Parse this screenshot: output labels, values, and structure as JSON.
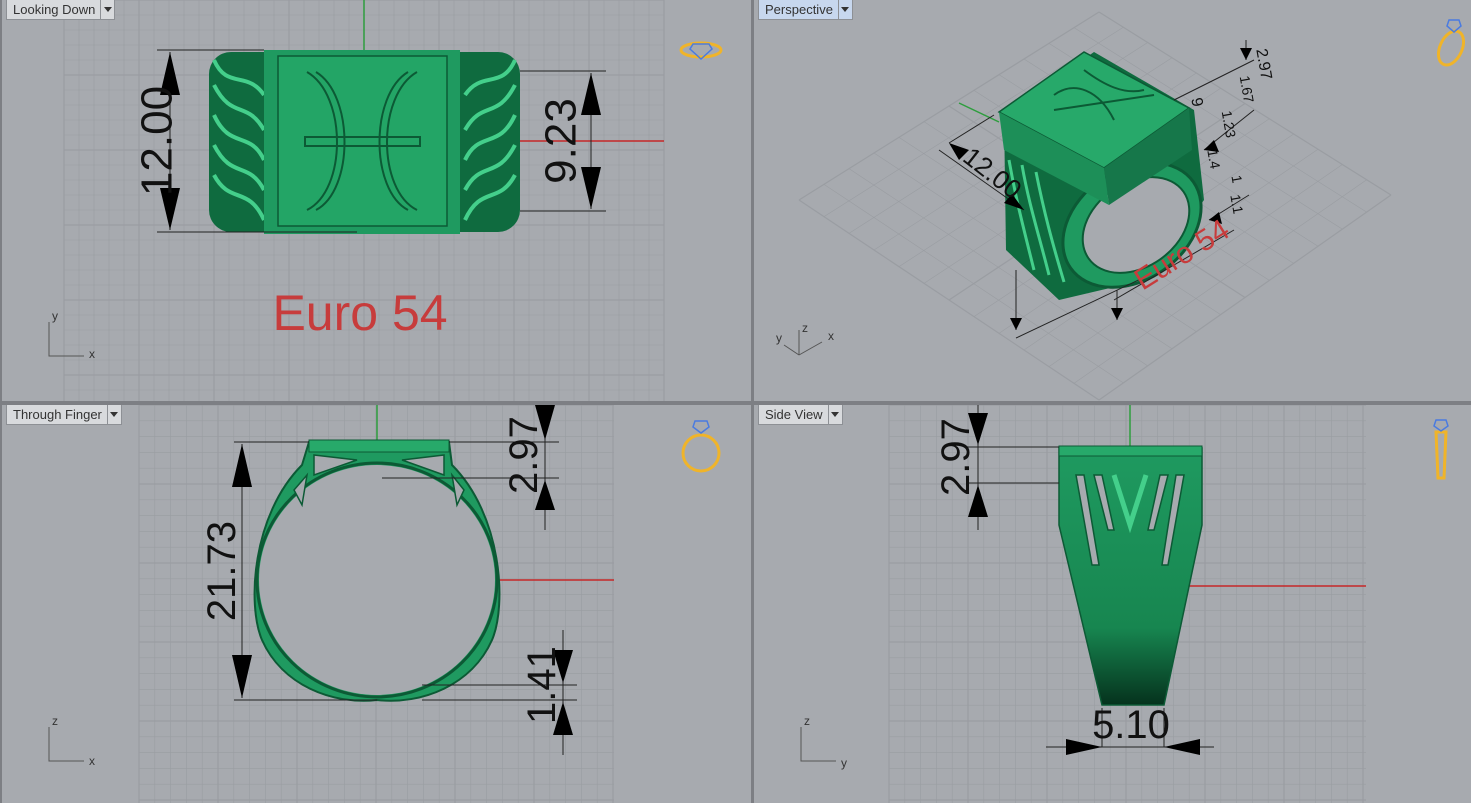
{
  "viewports": [
    {
      "title": "Looking Down",
      "active": false
    },
    {
      "title": "Perspective",
      "active": true
    },
    {
      "title": "Through Finger",
      "active": false
    },
    {
      "title": "Side View",
      "active": false
    }
  ],
  "top_view": {
    "dims": {
      "width": "12.00",
      "face": "9.23"
    },
    "size_label": "Euro 54",
    "axes": {
      "v": "y",
      "h": "x"
    }
  },
  "perspective_view": {
    "dims": {
      "width": "12.00",
      "top_a": "2.97",
      "mid_a": "1.67",
      "mid_b": "9",
      "mid_c": "1.23",
      "side_a": "1.4",
      "side_b": "1",
      "side_c": "1.1"
    },
    "size_label": "Euro 54",
    "axes": {
      "a": "y",
      "b": "z",
      "c": "x"
    }
  },
  "front_view": {
    "dims": {
      "height": "21.73",
      "top": "2.97",
      "bottom": "1.41"
    },
    "axes": {
      "v": "z",
      "h": "x"
    }
  },
  "side_view": {
    "dims": {
      "top": "2.97",
      "bottom": "5.10"
    },
    "axes": {
      "v": "z",
      "h": "y"
    }
  },
  "colors": {
    "ring": "#1f9a60",
    "ring_light": "#2fbd7a",
    "ring_dark": "#0c5a35",
    "size_label": "#c73c3c",
    "icon": "#f0b429",
    "axis_x": "#c62828",
    "axis_y": "#2e9e3e",
    "grid": "#9a9da2"
  }
}
